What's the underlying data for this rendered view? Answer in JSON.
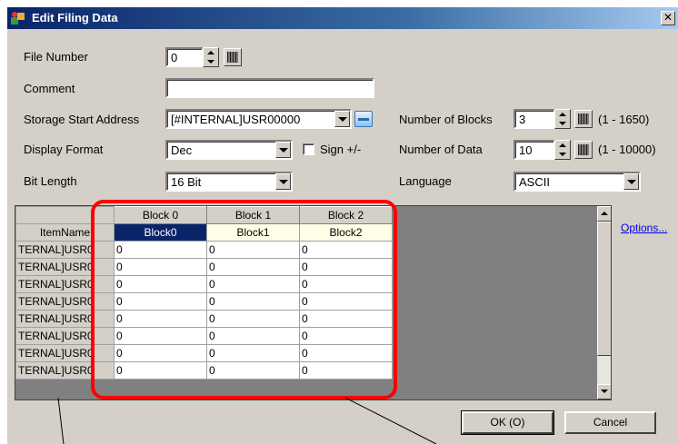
{
  "window": {
    "title": "Edit Filing Data",
    "close_glyph": "✕"
  },
  "form": {
    "file_number": {
      "label": "File Number",
      "value": "0"
    },
    "comment": {
      "label": "Comment",
      "value": ""
    },
    "storage_start_address": {
      "label": "Storage Start Address",
      "value": "[#INTERNAL]USR00000"
    },
    "display_format": {
      "label": "Display Format",
      "value": "Dec"
    },
    "sign": {
      "label": "Sign +/-",
      "checked": false
    },
    "bit_length": {
      "label": "Bit Length",
      "value": "16 Bit"
    },
    "number_of_blocks": {
      "label": "Number of Blocks",
      "value": "3",
      "range": "(1 - 1650)"
    },
    "number_of_data": {
      "label": "Number of Data",
      "value": "10",
      "range": "(1 - 10000)"
    },
    "language": {
      "label": "Language",
      "value": "ASCII"
    }
  },
  "grid": {
    "column_headers": [
      "Block 0",
      "Block 1",
      "Block 2"
    ],
    "item_name_header": "ItemName",
    "block_names": [
      "Block0",
      "Block1",
      "Block2"
    ],
    "row_label": "TERNAL]USR0",
    "rows": [
      [
        "0",
        "0",
        "0"
      ],
      [
        "0",
        "0",
        "0"
      ],
      [
        "0",
        "0",
        "0"
      ],
      [
        "0",
        "0",
        "0"
      ],
      [
        "0",
        "0",
        "0"
      ],
      [
        "0",
        "0",
        "0"
      ],
      [
        "0",
        "0",
        "0"
      ],
      [
        "0",
        "0",
        "0"
      ]
    ]
  },
  "options_link": "Options...",
  "buttons": {
    "ok": "OK (O)",
    "cancel": "Cancel"
  },
  "colors": {
    "highlight": "#ff0000",
    "selected_block": "#0a246a",
    "title_bar": "#0a246a"
  }
}
